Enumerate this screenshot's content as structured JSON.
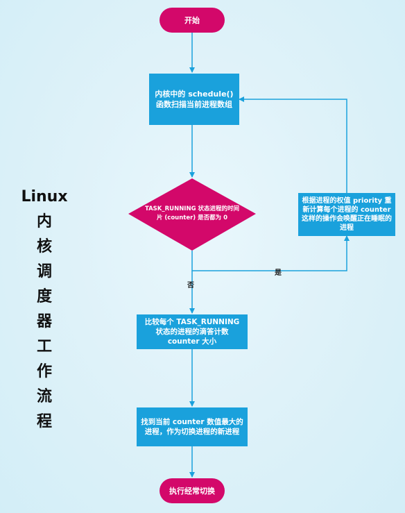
{
  "title": {
    "line1": "Linux",
    "chars": [
      "内",
      "核",
      "调",
      "度",
      "器",
      "工",
      "作",
      "流",
      "程"
    ]
  },
  "nodes": {
    "start": "开始",
    "scan": "内核中的 schedule() 函数扫描当前进程数组",
    "decision": "TASK_RUNNING 状态进程的时间片 (counter) 是否都为 0",
    "recalc": "根据进程的权值 priority 重新计算每个进程的 counter 这样的操作会唤醒正在睡眠的进程",
    "compare": "比较每个 TASK_RUNNING 状态的进程的滴答计数 counter 大小",
    "find": "找到当前 counter 数值最大的进程，作为切换进程的新进程",
    "end": "执行经常切换"
  },
  "edges": {
    "yes": "是",
    "no": "否"
  },
  "colors": {
    "terminal": "#d3086a",
    "decision": "#d3086a",
    "process": "#1aa1dc",
    "line": "#1aa1dc"
  }
}
